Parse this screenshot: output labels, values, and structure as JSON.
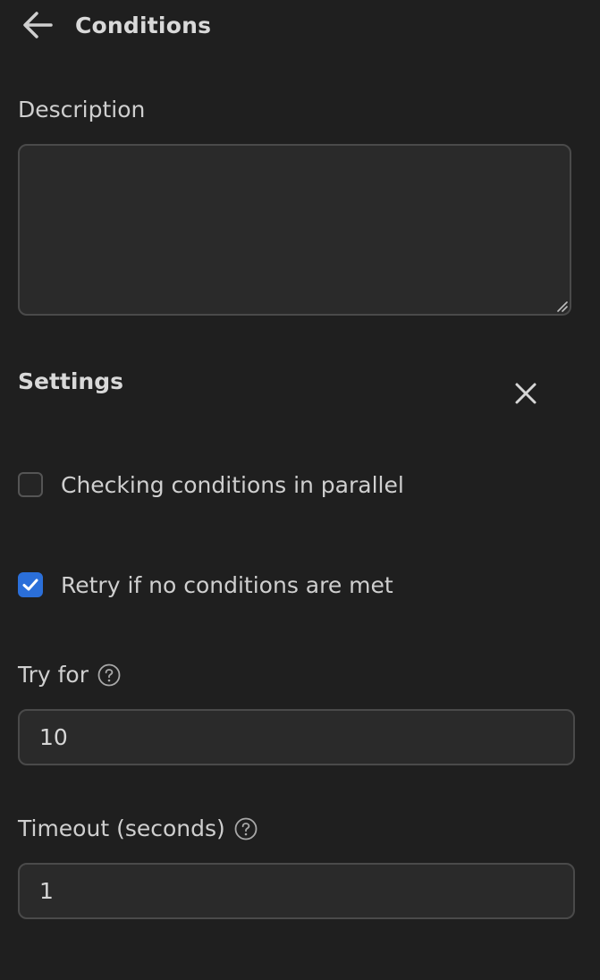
{
  "header": {
    "title": "Conditions",
    "back_icon": "arrow-left-icon"
  },
  "description": {
    "label": "Description",
    "value": ""
  },
  "settings": {
    "heading": "Settings",
    "close_icon": "close-icon"
  },
  "options": {
    "parallel": {
      "label": "Checking conditions in parallel",
      "checked": false
    },
    "retry": {
      "label": "Retry if no conditions are met",
      "checked": true
    }
  },
  "try_for": {
    "label": "Try for",
    "value": "10",
    "help_icon": "question-circle-icon"
  },
  "timeout": {
    "label": "Timeout (seconds)",
    "value": "1",
    "help_icon": "question-circle-icon"
  },
  "colors": {
    "background": "#1f1f1f",
    "field": "#2a2a2a",
    "border": "#4a4a4a",
    "accent": "#2b6fd9",
    "text": "#d6d6d6"
  }
}
